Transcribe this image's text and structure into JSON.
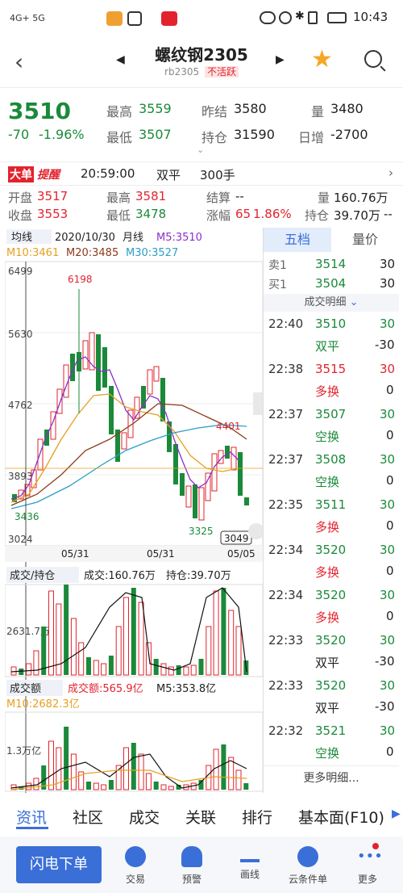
{
  "status": {
    "time": "10:43",
    "signal": "4G+ 5G"
  },
  "header": {
    "title": "螺纹钢2305",
    "code": "rb2305",
    "badge": "不活跃"
  },
  "quote": {
    "last": "3510",
    "change": "-70",
    "change_pct": "-1.96%",
    "high_label": "最高",
    "high": "3559",
    "low_label": "最低",
    "low": "3507",
    "prev_settle_label": "昨结",
    "prev_settle": "3580",
    "oi_label": "持仓",
    "oi": "31590",
    "vol_label": "量",
    "vol": "3480",
    "daily_add_label": "日增",
    "daily_add": "-2700"
  },
  "alert": {
    "tag1": "大单",
    "tag2": "提醒",
    "time": "20:59:00",
    "type": "双平",
    "qty": "300手"
  },
  "stats": {
    "open_label": "开盘",
    "open": "3517",
    "high_label": "最高",
    "high": "3581",
    "settle_label": "结算",
    "settle": "--",
    "vol_label": "量",
    "vol": "160.76万",
    "close_label": "收盘",
    "close": "3553",
    "low_label": "最低",
    "low": "3478",
    "chg_label": "涨幅",
    "chg": "65",
    "chg_pct": "1.86%",
    "oi_label": "持仓",
    "oi": "39.70万",
    "oi_chg": "--"
  },
  "kchart": {
    "ma_label": "均线",
    "date": "2020/10/30",
    "period": "月线",
    "ma5": "M5:3510",
    "ma10": "M10:3461",
    "ma20": "M20:3485",
    "ma30": "M30:3527",
    "y_top": "6499",
    "y_2": "5630",
    "y_3": "4762",
    "y_4": "3893",
    "y_bottom": "3024",
    "mark_high": "6198",
    "mark_low1": "3436",
    "mark_low2": "3325",
    "mark_peak": "4401",
    "mark_current": "3049",
    "x_labels": [
      "05/31",
      "05/31",
      "05/05"
    ]
  },
  "volchart": {
    "label": "成交/持仓",
    "vol": "成交:160.76万",
    "oi": "持仓:39.70万",
    "y_label": "2631.7万"
  },
  "amtchart": {
    "label": "成交额",
    "amt": "成交额:565.9亿",
    "m5": "M5:353.8亿",
    "m10": "M10:2682.3亿",
    "y_label": "1.3万亿"
  },
  "book": {
    "tab_active": "五档",
    "tab_other": "量价",
    "sell_label": "卖1",
    "sell_price": "3514",
    "sell_qty": "30",
    "buy_label": "买1",
    "buy_price": "3504",
    "buy_qty": "30",
    "detail_label": "成交明细",
    "more": "更多明细...",
    "trades": [
      {
        "time": "22:40",
        "price": "3510",
        "qty": "30",
        "type": "双平",
        "chg": "-30",
        "pc": "green",
        "tc": "green"
      },
      {
        "time": "22:38",
        "price": "3515",
        "qty": "30",
        "type": "多换",
        "chg": "0",
        "pc": "red",
        "tc": "red"
      },
      {
        "time": "22:37",
        "price": "3507",
        "qty": "30",
        "type": "空换",
        "chg": "0",
        "pc": "green",
        "tc": "green"
      },
      {
        "time": "22:37",
        "price": "3508",
        "qty": "30",
        "type": "空换",
        "chg": "0",
        "pc": "green",
        "tc": "green"
      },
      {
        "time": "22:35",
        "price": "3511",
        "qty": "30",
        "type": "多换",
        "chg": "0",
        "pc": "green",
        "tc": "red"
      },
      {
        "time": "22:34",
        "price": "3520",
        "qty": "30",
        "type": "多换",
        "chg": "0",
        "pc": "green",
        "tc": "red"
      },
      {
        "time": "22:34",
        "price": "3520",
        "qty": "30",
        "type": "多换",
        "chg": "0",
        "pc": "green",
        "tc": "red"
      },
      {
        "time": "22:33",
        "price": "3520",
        "qty": "30",
        "type": "双平",
        "chg": "-30",
        "pc": "green",
        "tc": "dark"
      },
      {
        "time": "22:33",
        "price": "3520",
        "qty": "30",
        "type": "双平",
        "chg": "-30",
        "pc": "green",
        "tc": "dark"
      },
      {
        "time": "22:32",
        "price": "3521",
        "qty": "30",
        "type": "空换",
        "chg": "0",
        "pc": "green",
        "tc": "green"
      }
    ]
  },
  "tabs": [
    "资讯",
    "社区",
    "成交",
    "关联",
    "排行",
    "基本面(F10)"
  ],
  "bottom": {
    "trade_button": "闪电下单",
    "items": [
      "交易",
      "预警",
      "画线",
      "云条件单",
      "更多"
    ]
  },
  "colors": {
    "up": "#e2232e",
    "down": "#1a8a3a",
    "accent": "#3a6fd8",
    "star": "#f5a623"
  }
}
